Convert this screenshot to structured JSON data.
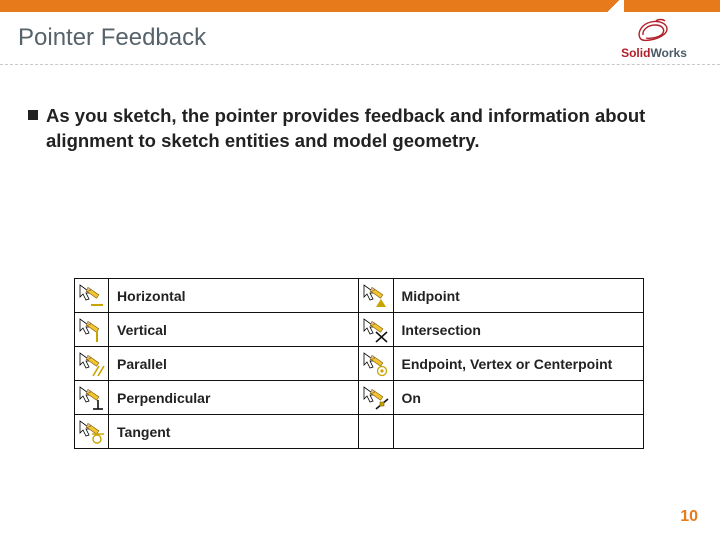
{
  "header": {
    "title": "Pointer Feedback",
    "brand_red": "Solid",
    "brand_gray": "Works"
  },
  "content": {
    "paragraph": "As you sketch, the pointer provides feedback and information about alignment to sketch entities and model geometry."
  },
  "table": {
    "rows": [
      {
        "left_icon": "horizontal",
        "left_label": "Horizontal",
        "right_icon": "midpoint",
        "right_label": "Midpoint"
      },
      {
        "left_icon": "vertical",
        "left_label": "Vertical",
        "right_icon": "intersection",
        "right_label": "Intersection"
      },
      {
        "left_icon": "parallel",
        "left_label": "Parallel",
        "right_icon": "endpoint",
        "right_label": "Endpoint, Vertex or Centerpoint"
      },
      {
        "left_icon": "perpendicular",
        "left_label": "Perpendicular",
        "right_icon": "on",
        "right_label": "On"
      },
      {
        "left_icon": "tangent",
        "left_label": "Tangent",
        "right_icon": "",
        "right_label": ""
      }
    ]
  },
  "footer": {
    "page_number": "10"
  }
}
